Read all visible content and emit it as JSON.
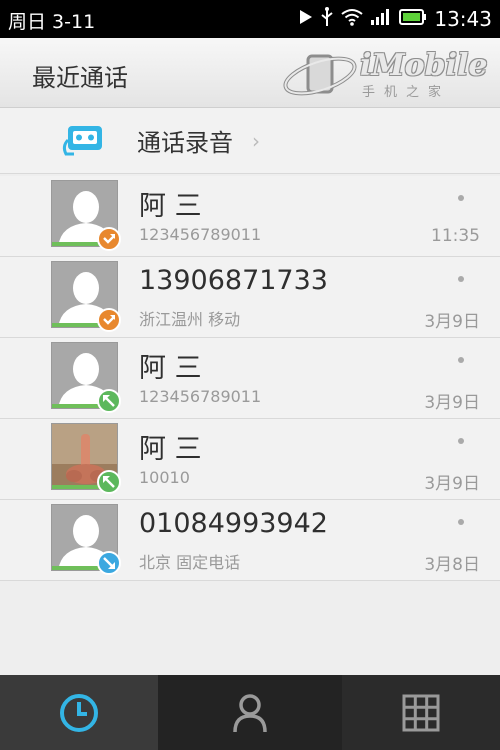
{
  "status_bar": {
    "date": "周日 3-11",
    "time": "13:43",
    "icons": [
      "play-icon",
      "usb-icon",
      "wifi-icon",
      "signal-icon",
      "battery-icon"
    ]
  },
  "header": {
    "title": "最近通话",
    "logo_text": "iMobile",
    "logo_subtitle": "手机之家"
  },
  "recording_row": {
    "label": "通话录音",
    "icon": "tape-icon"
  },
  "calls": [
    {
      "name": "阿 三",
      "detail": "123456789011",
      "time": "11:35",
      "type": "outgoing",
      "avatar": "default"
    },
    {
      "name": "13906871733",
      "detail": "浙江温州 移动",
      "time": "3月9日",
      "type": "outgoing",
      "avatar": "default"
    },
    {
      "name": "阿 三",
      "detail": "123456789011",
      "time": "3月9日",
      "type": "incoming",
      "avatar": "default"
    },
    {
      "name": "阿 三",
      "detail": "10010",
      "time": "3月9日",
      "type": "incoming",
      "avatar": "photo"
    },
    {
      "name": "01084993942",
      "detail": "北京 固定电话",
      "time": "3月8日",
      "type": "missed",
      "avatar": "default"
    }
  ],
  "call_type_colors": {
    "outgoing": "#e8882e",
    "incoming": "#5cb85c",
    "missed": "#3ba8e0"
  },
  "accent_color": "#33b5e5",
  "bottom_nav": [
    {
      "name": "recent-calls",
      "icon": "clock-icon",
      "active": true
    },
    {
      "name": "contacts",
      "icon": "person-icon",
      "active": false
    },
    {
      "name": "dialpad",
      "icon": "grid-icon",
      "active": false
    }
  ]
}
